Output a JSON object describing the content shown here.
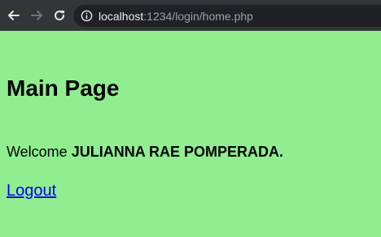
{
  "browser": {
    "url_host": "localhost",
    "url_path": ":1234/login/home.php",
    "icons": [
      "back-arrow-icon",
      "forward-arrow-icon",
      "reload-icon",
      "info-icon"
    ]
  },
  "page": {
    "background_color": "#90ee90",
    "heading": "Main Page",
    "welcome_prefix": "Welcome ",
    "user_name": "JULIANNA RAE POMPERADA.",
    "logout_label": "Logout"
  }
}
